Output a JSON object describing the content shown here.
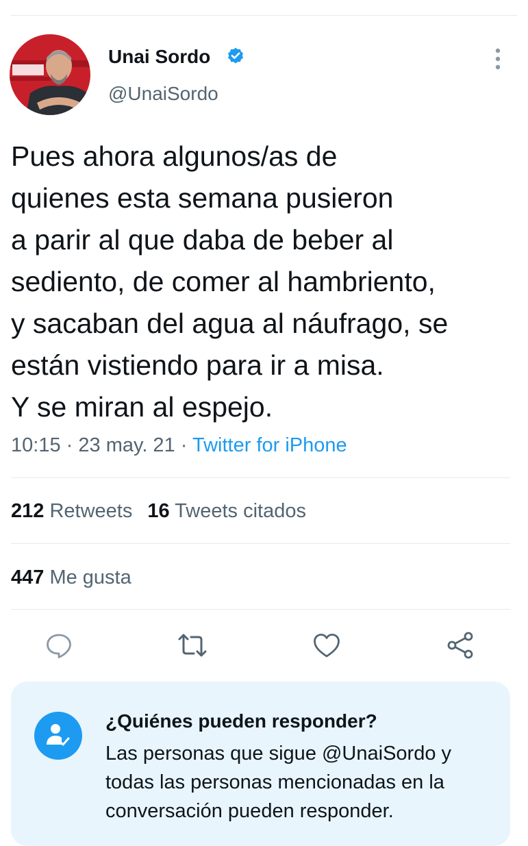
{
  "author": {
    "name": "Unai Sordo",
    "handle": "@UnaiSordo",
    "verified": true,
    "avatar_icon": "profile-photo"
  },
  "tweet": {
    "text": "Pues ahora algunos/as de\nquienes esta semana pusieron\na parir al que daba de beber al\nsediento, de comer al hambriento,\ny sacaban del agua al náufrago, se\nestán vistiendo para ir a misa.\nY se miran al espejo.",
    "time": "10:15",
    "date": "23 may. 21",
    "separator": "·",
    "source": "Twitter for iPhone"
  },
  "stats": {
    "retweets_count": "212",
    "retweets_label": "Retweets",
    "quotes_count": "16",
    "quotes_label": "Tweets citados",
    "likes_count": "447",
    "likes_label": "Me gusta"
  },
  "actions": {
    "reply_icon": "reply-icon",
    "retweet_icon": "retweet-icon",
    "like_icon": "heart-icon",
    "share_icon": "share-icon"
  },
  "reply_restriction": {
    "title": "¿Quiénes pueden responder?",
    "text": "Las personas que sigue @UnaiSordo y todas las personas mencionadas en la conversación pueden responder.",
    "icon": "person-check-icon"
  },
  "colors": {
    "accent": "#1d9bf0",
    "text_primary": "#0f1419",
    "text_secondary": "#536471",
    "divider": "#e6e9eb",
    "panel_background": "#e8f5fd"
  }
}
